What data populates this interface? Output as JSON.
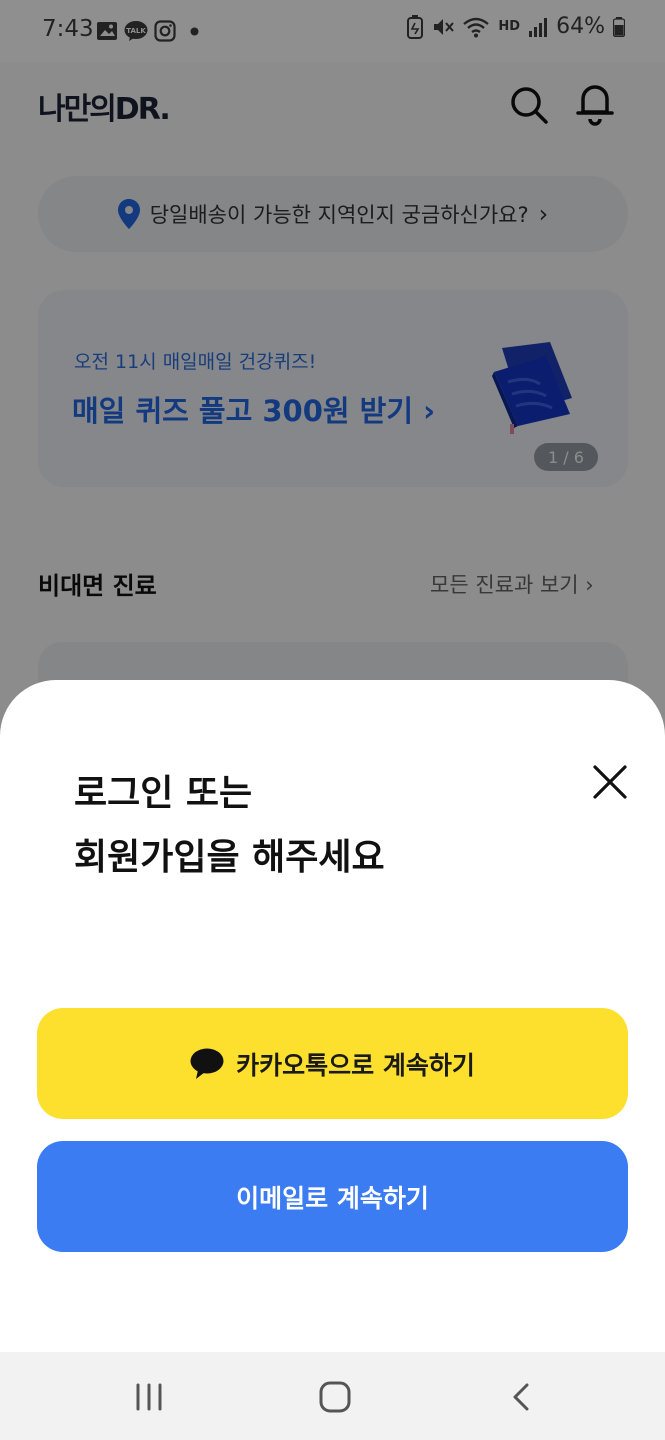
{
  "status_bar": {
    "time": "7:43",
    "battery": "64%",
    "left_icons": [
      "gallery-icon",
      "kakaotalk-notification-icon",
      "instagram-icon",
      "dot-icon"
    ],
    "right_icons": [
      "battery-saver-icon",
      "mute-icon",
      "wifi-icon",
      "hd-voice-icon",
      "signal-icon",
      "battery-icon"
    ],
    "talk_label": "TALK",
    "hd_label": "HD"
  },
  "header": {
    "logo": "나만의DR.",
    "search_icon": "search-icon",
    "bell_icon": "bell-icon"
  },
  "delivery_pill": {
    "label": "당일배송이 가능한 지역인지 궁금하신가요?",
    "chevron": "›"
  },
  "banner": {
    "subtitle": "오전 11시 매일매일 건강퀴즈!",
    "title": "매일 퀴즈 풀고 300원 받기 ›",
    "page_indicator": "1 / 6"
  },
  "section": {
    "title": "비대면 진료",
    "link": "모든 진료과 보기 ›"
  },
  "sheet": {
    "title_line1": "로그인 또는",
    "title_line2": "회원가입을 해주세요",
    "kakao_button": "카카오톡으로 계속하기",
    "email_button": "이메일로 계속하기"
  },
  "colors": {
    "kakao_yellow": "#fde02e",
    "email_blue": "#3b7cf2",
    "banner_blue": "#2368e8"
  }
}
